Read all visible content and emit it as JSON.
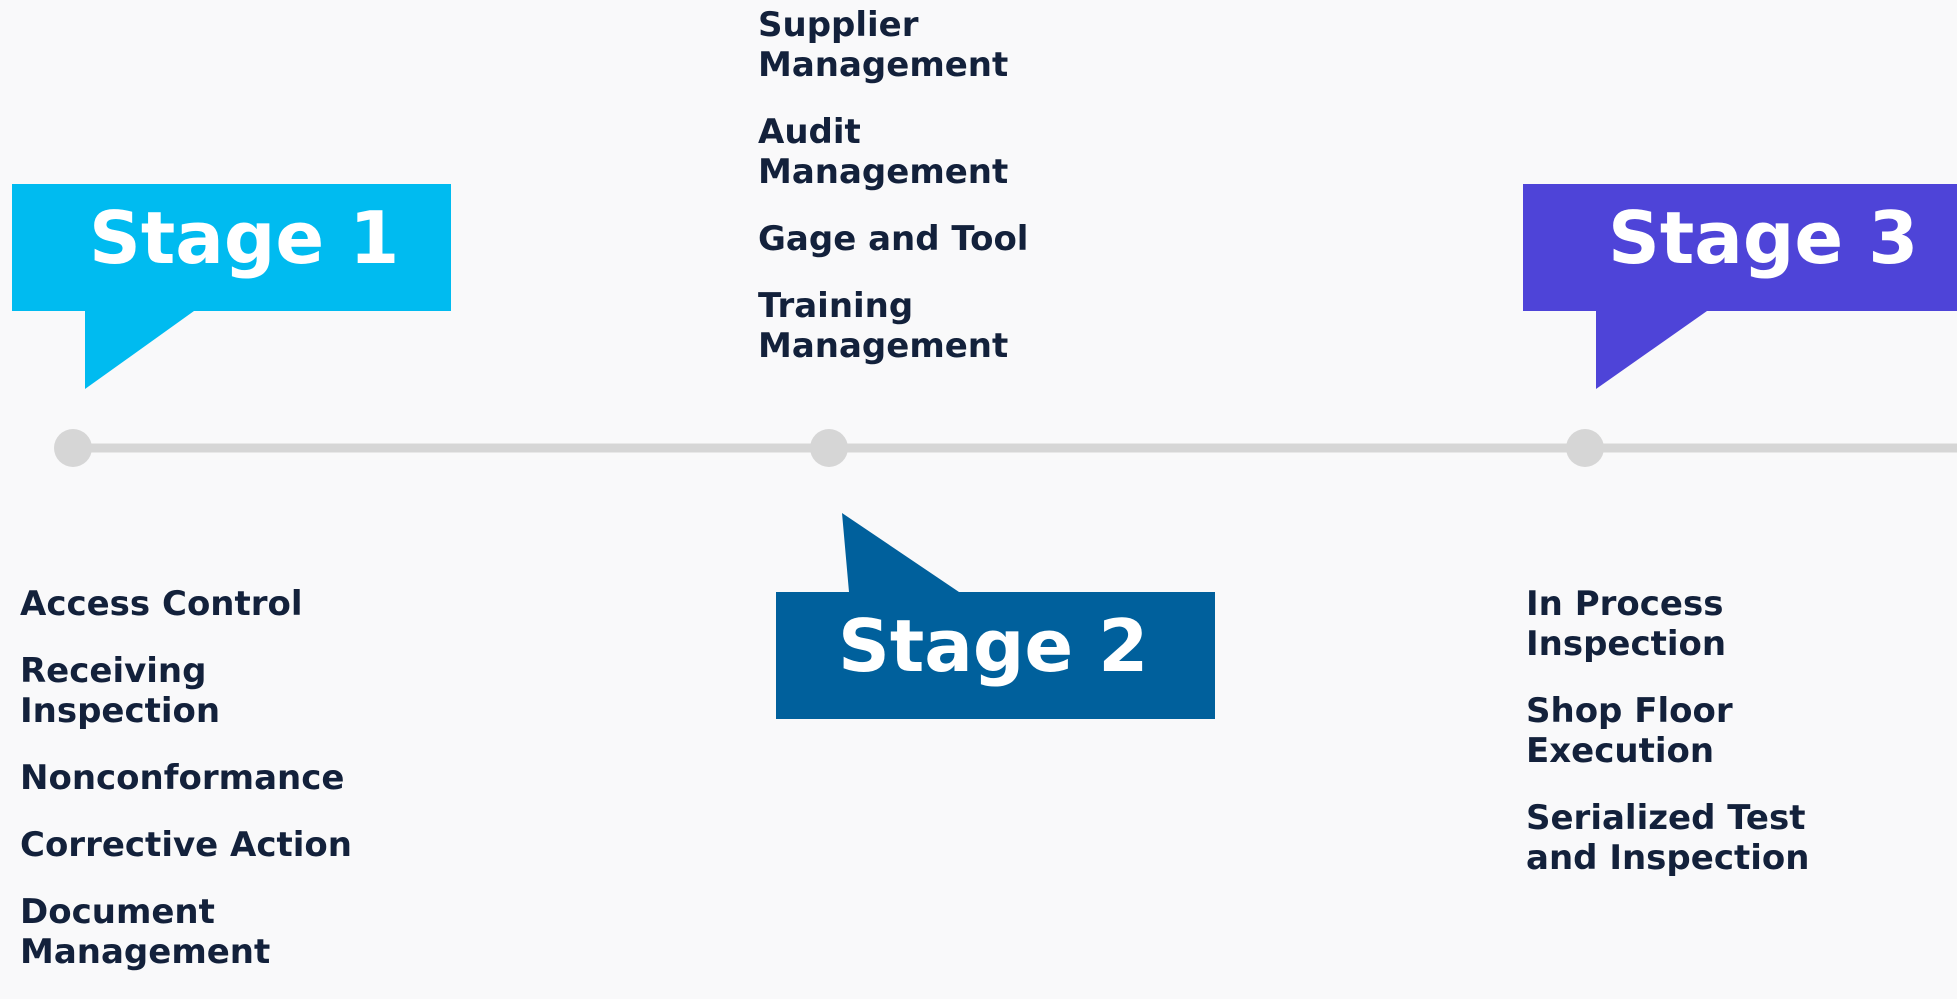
{
  "stages": [
    {
      "label": "Stage 1",
      "color": "#00bbf0",
      "items": [
        "Access Control",
        "Receiving Inspection",
        "Nonconformance",
        "Corrective Action",
        "Document Management"
      ]
    },
    {
      "label": "Stage 2",
      "color": "#00609c",
      "items": [
        "Supplier Management",
        "Audit Management",
        "Gage and Tool",
        "Training Management"
      ]
    },
    {
      "label": "Stage 3",
      "color": "#4e44d8",
      "items": [
        "In Process Inspection",
        "Shop Floor Execution",
        "Serialized Test and Inspection"
      ]
    }
  ],
  "timeline_color": "#d6d6d6",
  "text_color": "#13213b"
}
